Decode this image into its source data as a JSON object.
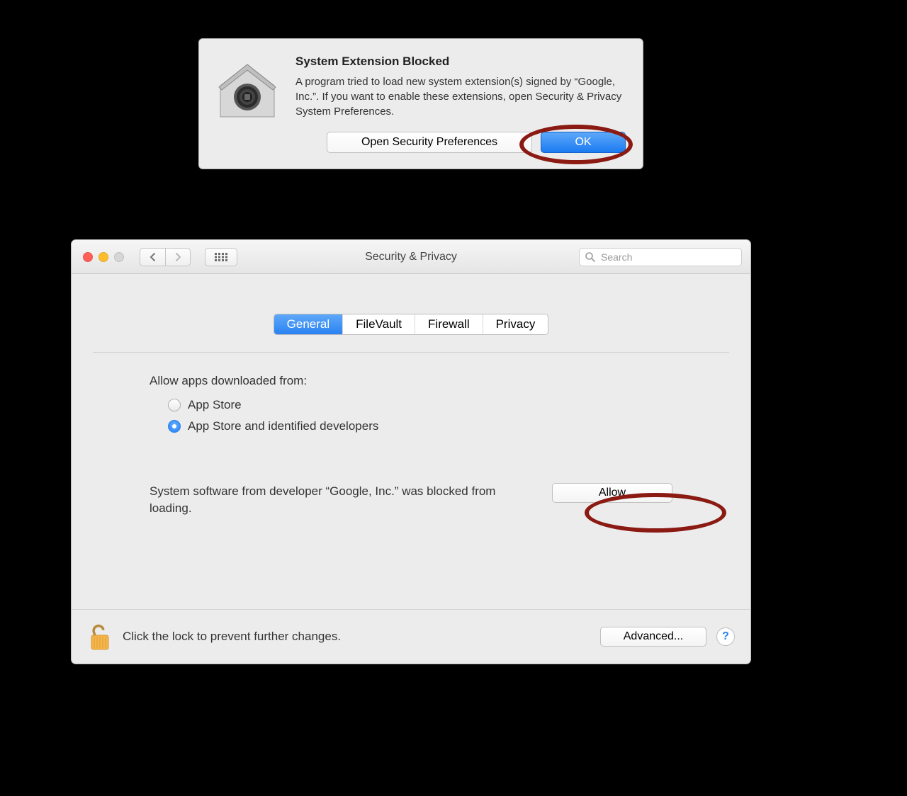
{
  "alert": {
    "title": "System Extension Blocked",
    "body": "A program tried to load new system extension(s) signed by “Google, Inc.”.  If you want to enable these extensions, open Security & Privacy System Preferences.",
    "open_prefs_label": "Open Security Preferences",
    "ok_label": "OK"
  },
  "prefs": {
    "window_title": "Security & Privacy",
    "search_placeholder": "Search",
    "tabs": {
      "general": "General",
      "filevault": "FileVault",
      "firewall": "Firewall",
      "privacy": "Privacy"
    },
    "allow_section_label": "Allow apps downloaded from:",
    "radio_app_store": "App Store",
    "radio_app_store_identified": "App Store and identified developers",
    "blocked_message": "System software from developer “Google, Inc.” was blocked from loading.",
    "allow_button": "Allow",
    "lock_text": "Click the lock to prevent further changes.",
    "advanced_button": "Advanced...",
    "help_button": "?"
  }
}
